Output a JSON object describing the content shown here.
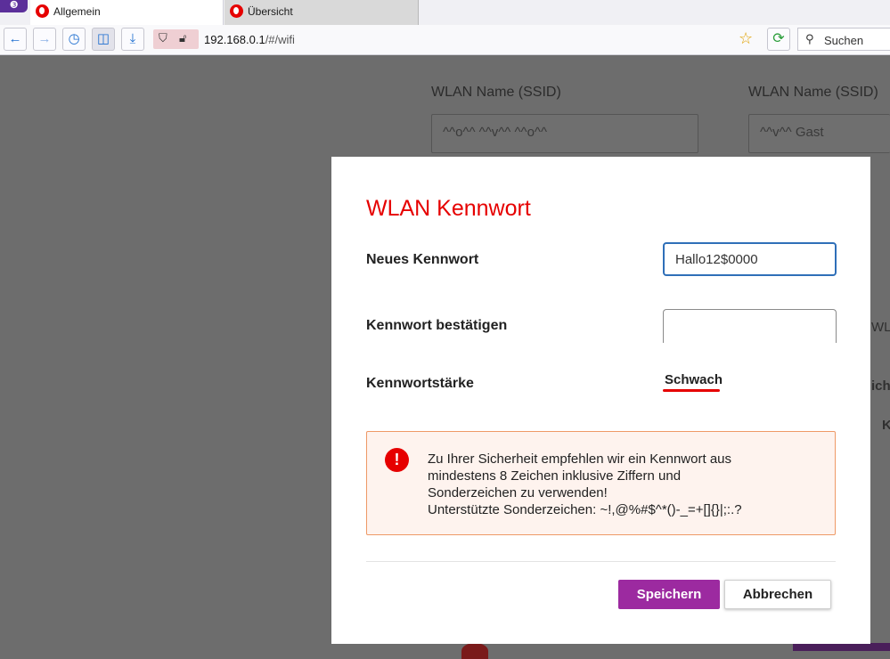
{
  "browser": {
    "tabs": [
      {
        "label": "Allgemein",
        "active": true
      },
      {
        "label": "Übersicht",
        "active": false
      }
    ],
    "url_host": "192.168.0.1",
    "url_path": "/#/wifi",
    "search_placeholder": "Suchen"
  },
  "background_page": {
    "ssid_label_1": "WLAN Name (SSID)",
    "ssid_value_1": "^^o^^ ^^v^^ ^^o^^",
    "ssid_label_2": "WLAN Name (SSID)",
    "ssid_value_2": "^^v^^ Gast",
    "fragment_1": "WL",
    "fragment_2": "ich",
    "fragment_3": "K"
  },
  "dialog": {
    "title": "WLAN Kennwort",
    "new_password_label": "Neues Kennwort",
    "new_password_value": "Hallo12$0000",
    "confirm_label": "Kennwort bestätigen",
    "confirm_value": "",
    "strength_label": "Kennwortstärke",
    "strength_value": "Schwach",
    "alert_lines": [
      "Zu Ihrer Sicherheit empfehlen wir ein Kennwort aus",
      "mindestens 8 Zeichen inklusive Ziffern und",
      "Sonderzeichen zu verwenden!",
      "Unterstützte Sonderzeichen: ~!,@%#$^*()-_=+[]{}|;:.?"
    ],
    "save_label": "Speichern",
    "cancel_label": "Abbrechen"
  },
  "colors": {
    "brand_red": "#e60000",
    "button_purple": "#9c2aa0",
    "overlay": "#6d6d6d"
  }
}
